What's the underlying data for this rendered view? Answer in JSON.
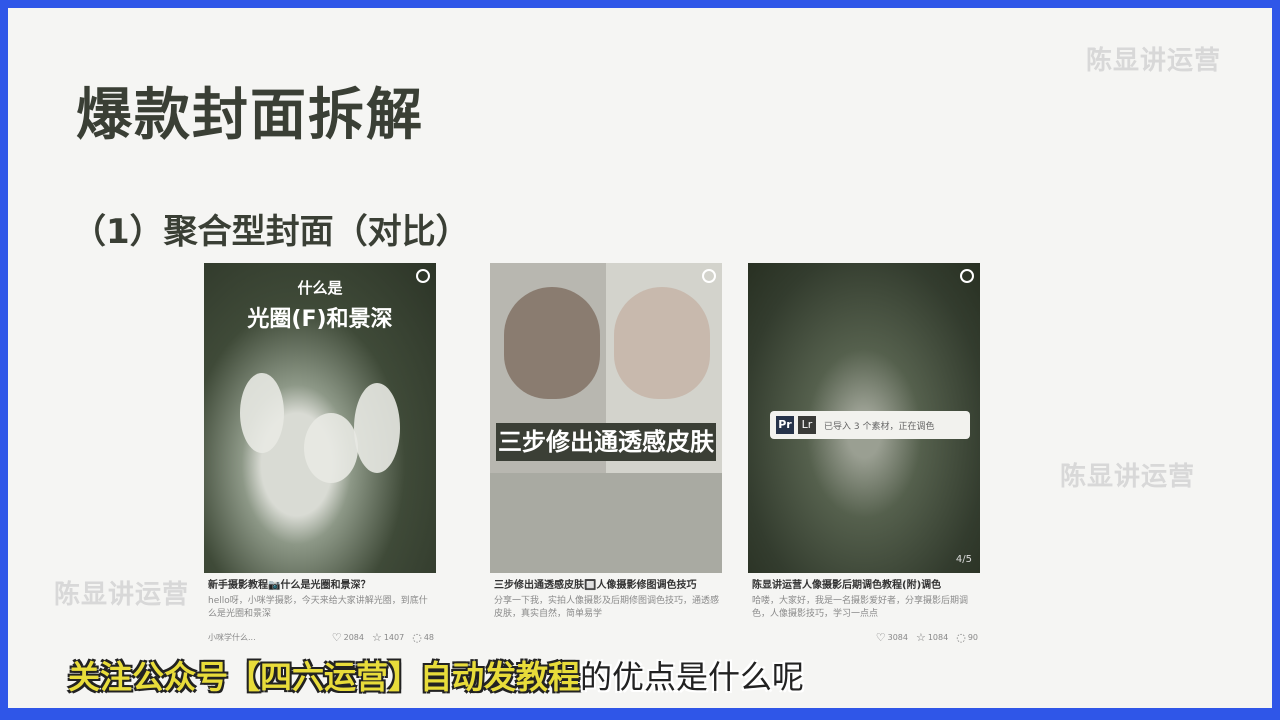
{
  "slide": {
    "title": "爆款封面拆解",
    "subtitle": "（1）聚合型封面（对比）",
    "watermark": "陈显讲运营"
  },
  "cards": [
    {
      "cover_small": "什么是",
      "cover_big": "光圈(F)和景深",
      "title": "新手摄影教程📷什么是光圈和景深？",
      "desc": "hello呀，小咪学摄影，今天来给大家讲解光圈，到底什么是光圈和景深",
      "author": "小咪学什么...",
      "likes": "2084",
      "stars": "1407",
      "comments": "48"
    },
    {
      "cover_banner": "三步修出通透感皮肤",
      "title": "三步修出通透感皮肤🔲人像摄影修图调色技巧",
      "desc": "分享一下我，实拍人像摄影及后期修图调色技巧，通透感皮肤，真实自然，简单易学",
      "author": "",
      "likes": "",
      "stars": "",
      "comments": ""
    },
    {
      "ad_logo1": "Pr",
      "ad_logo2": "Lr",
      "ad_text": "已导入 3 个素材，正在调色",
      "stamp": "4/5",
      "title": "陈显讲运营人像摄影后期调色教程(附)调色",
      "desc": "哈喽，大家好，我是一名摄影爱好者，分享摄影后期调色，人像摄影技巧，学习一点点",
      "author": "",
      "likes": "3084",
      "stars": "1084",
      "comments": "90"
    }
  ],
  "caption": {
    "highlight": "关注公众号【四六运营】自动发教程",
    "rest": "的优点是什么呢"
  },
  "icons": [
    "heart-icon",
    "star-icon",
    "comment-icon"
  ],
  "colors": {
    "frame": "#2f56e8",
    "slide_bg": "#f5f5f3",
    "title": "#3a3f35",
    "caption_highlight": "#e8dc3a"
  }
}
